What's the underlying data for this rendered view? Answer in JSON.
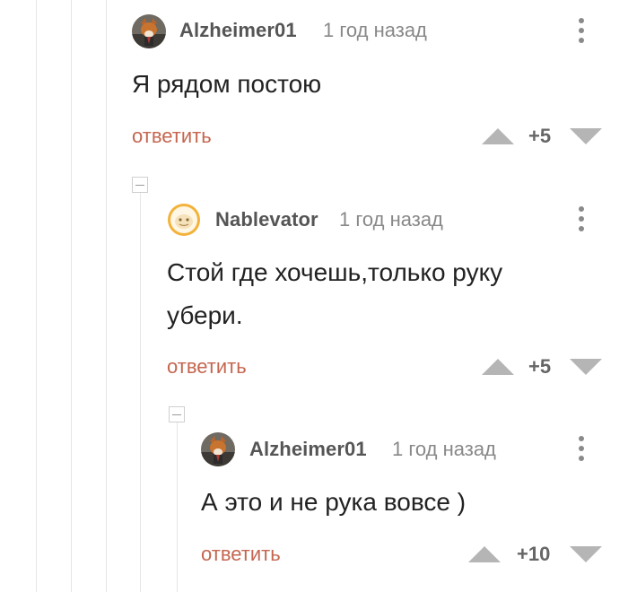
{
  "comments": [
    {
      "author": "Alzheimer01",
      "time": "1 год назад",
      "text": "Я рядом постою",
      "reply_label": "ответить",
      "rating": "+5"
    },
    {
      "author": "Nablevator",
      "time": "1 год назад",
      "text_line1": "Стой где хочешь,только руку",
      "text_line2": "убери.",
      "reply_label": "ответить",
      "rating": "+5"
    },
    {
      "author": "Alzheimer01",
      "time": "1 год назад",
      "text": "А это и не рука вовсе )",
      "reply_label": "ответить",
      "rating": "+10"
    }
  ],
  "colors": {
    "reply_link": "#c5664f",
    "vote_arrow": "#b5b5b5",
    "thread_line": "#e6e6e6"
  },
  "icons": [
    "avatar-fox",
    "avatar-orange-round",
    "kebab-menu-icon",
    "vote-up-icon",
    "vote-down-icon",
    "collapse-icon"
  ]
}
